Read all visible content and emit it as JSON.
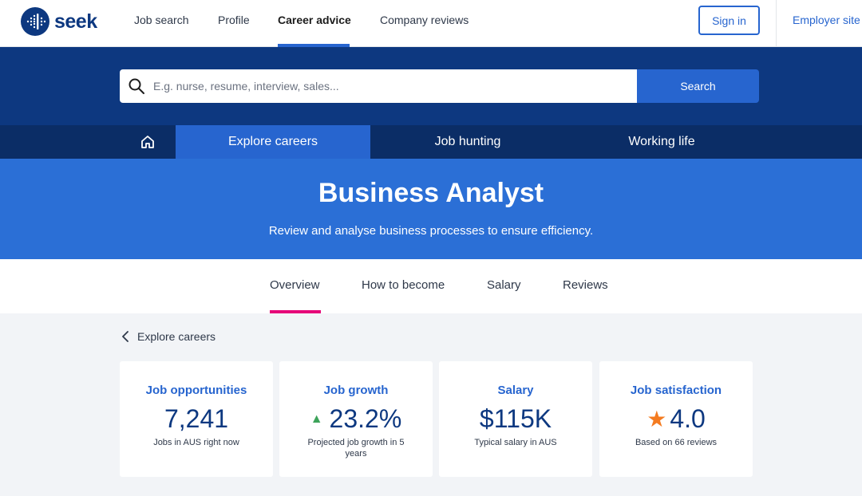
{
  "brand": {
    "logo_text": "seek"
  },
  "topnav": {
    "links": [
      {
        "label": "Job search"
      },
      {
        "label": "Profile"
      },
      {
        "label": "Career advice"
      },
      {
        "label": "Company reviews"
      }
    ],
    "sign_in": "Sign in",
    "employer_site": "Employer site"
  },
  "search": {
    "placeholder": "E.g. nurse, resume, interview, sales...",
    "value": "",
    "button": "Search"
  },
  "section_tabs": [
    {
      "label": "Explore careers"
    },
    {
      "label": "Job hunting"
    },
    {
      "label": "Working life"
    }
  ],
  "hero": {
    "title": "Business Analyst",
    "subtitle": "Review and analyse business processes to ensure efficiency."
  },
  "page_tabs": [
    {
      "label": "Overview"
    },
    {
      "label": "How to become"
    },
    {
      "label": "Salary"
    },
    {
      "label": "Reviews"
    }
  ],
  "back_link": "Explore careers",
  "stats": [
    {
      "title": "Job opportunities",
      "value": "7,241",
      "caption": "Jobs in AUS right now"
    },
    {
      "title": "Job growth",
      "value": "23.2%",
      "caption": "Projected job growth in 5 years"
    },
    {
      "title": "Salary",
      "value": "$115K",
      "caption": "Typical salary in AUS"
    },
    {
      "title": "Job satisfaction",
      "value": "4.0",
      "caption": "Based on 66 reviews"
    }
  ],
  "colors": {
    "brand_navy": "#0d3880",
    "accent_blue": "#2765cf",
    "hero_blue": "#2b6fd6",
    "active_underline": "#e60278",
    "growth_green": "#3da35a",
    "star_orange": "#f47b20"
  },
  "icons": {
    "logo": "seek-logo-icon",
    "search": "search-icon",
    "home": "home-icon",
    "back": "chevron-left-icon",
    "growth": "triangle-up-icon",
    "rating": "star-icon"
  }
}
